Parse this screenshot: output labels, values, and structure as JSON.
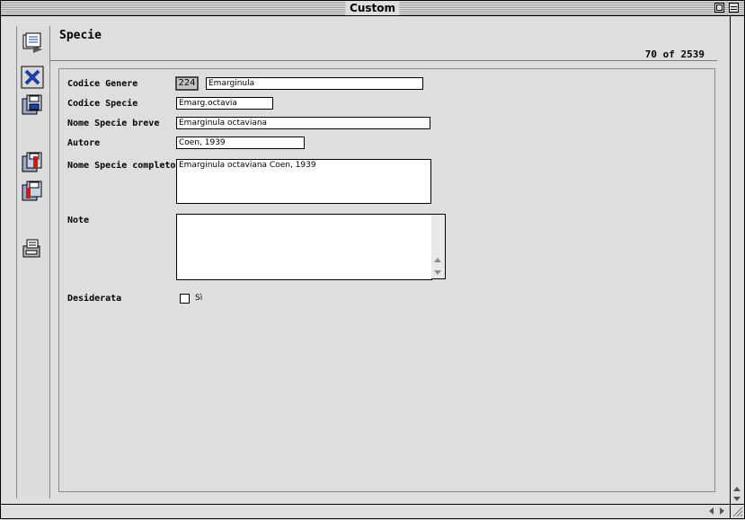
{
  "window": {
    "title": "Custom"
  },
  "header": {
    "title": "Specie",
    "record_count": "70 of 2539"
  },
  "toolbar": {
    "icons": [
      "list-view-icon",
      "delete-record-icon",
      "save-icon",
      "save-red-icon",
      "save-red-icon-2",
      "print-icon"
    ]
  },
  "form": {
    "codice_genere": {
      "label": "Codice Genere",
      "code": "224",
      "value": "Emarginula"
    },
    "codice_specie": {
      "label": "Codice Specie",
      "value": "Emarg.octavia"
    },
    "nome_specie_breve": {
      "label": "Nome Specie breve",
      "value": "Emarginula octaviana"
    },
    "autore": {
      "label": "Autore",
      "value": "Coen, 1939"
    },
    "nome_specie_completo": {
      "label": "Nome Specie completo",
      "value": "Emarginula octaviana Coen, 1939"
    },
    "note": {
      "label": "Note",
      "value": ""
    },
    "desiderata": {
      "label": "Desiderata",
      "option_label": "Sì",
      "checked": false
    }
  },
  "colors": {
    "accent_blue": "#1f3fa8",
    "accent_red": "#d01818",
    "background": "#dedede"
  }
}
